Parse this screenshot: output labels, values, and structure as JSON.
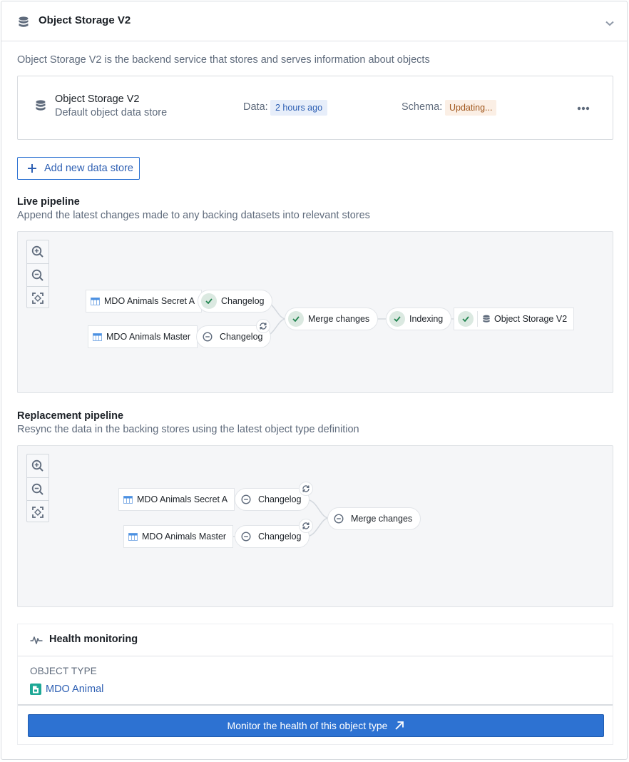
{
  "panel": {
    "title": "Object Storage V2",
    "icon": "database-icon",
    "collapse_icon": "chevron-down-icon",
    "description": "Object Storage V2 is the backend service that stores and serves information about objects"
  },
  "data_store": {
    "name": "Object Storage V2",
    "subtitle": "Default object data store",
    "data_label": "Data:",
    "data_value": "2 hours ago",
    "schema_label": "Schema:",
    "schema_value": "Updating...",
    "more_label": "•••",
    "colors": {
      "data_tag_bg": "#e7eefa",
      "data_tag_text": "#2d5fb3",
      "schema_tag_bg": "#fbefe5",
      "schema_tag_text": "#a0561b"
    }
  },
  "add_store_button": {
    "label": "Add new data store",
    "icon": "plus-icon"
  },
  "live_pipeline": {
    "title": "Live pipeline",
    "subtitle": "Append the latest changes made to any backing datasets into relevant stores",
    "zoom_controls": [
      "zoom-in-icon",
      "zoom-out-icon",
      "fit-to-screen-icon"
    ],
    "nodes": {
      "source_a": "MDO Animals Secret A",
      "source_b": "MDO Animals Master",
      "changelog_a": {
        "label": "Changelog",
        "status": "success"
      },
      "changelog_b": {
        "label": "Changelog",
        "status": "pending",
        "syncing": true
      },
      "merge": {
        "label": "Merge changes",
        "status": "success"
      },
      "indexing": {
        "label": "Indexing",
        "status": "success"
      },
      "store": {
        "label": "Object Storage V2",
        "status": "success"
      }
    }
  },
  "replacement_pipeline": {
    "title": "Replacement pipeline",
    "subtitle": "Resync the data in the backing stores using the latest object type definition",
    "zoom_controls": [
      "zoom-in-icon",
      "zoom-out-icon",
      "fit-to-screen-icon"
    ],
    "nodes": {
      "source_a": "MDO Animals Secret A",
      "source_b": "MDO Animals Master",
      "changelog_a": {
        "label": "Changelog",
        "status": "pending",
        "syncing": true
      },
      "changelog_b": {
        "label": "Changelog",
        "status": "pending",
        "syncing": true
      },
      "merge": {
        "label": "Merge changes",
        "status": "pending"
      }
    }
  },
  "health": {
    "title": "Health monitoring",
    "icon": "pulse-icon",
    "object_type_label": "OBJECT TYPE",
    "object_type_value": "MDO Animal",
    "monitor_button": "Monitor the health of this object type",
    "colors": {
      "button": "#2d72d2",
      "object_icon": "#1ea896"
    }
  }
}
